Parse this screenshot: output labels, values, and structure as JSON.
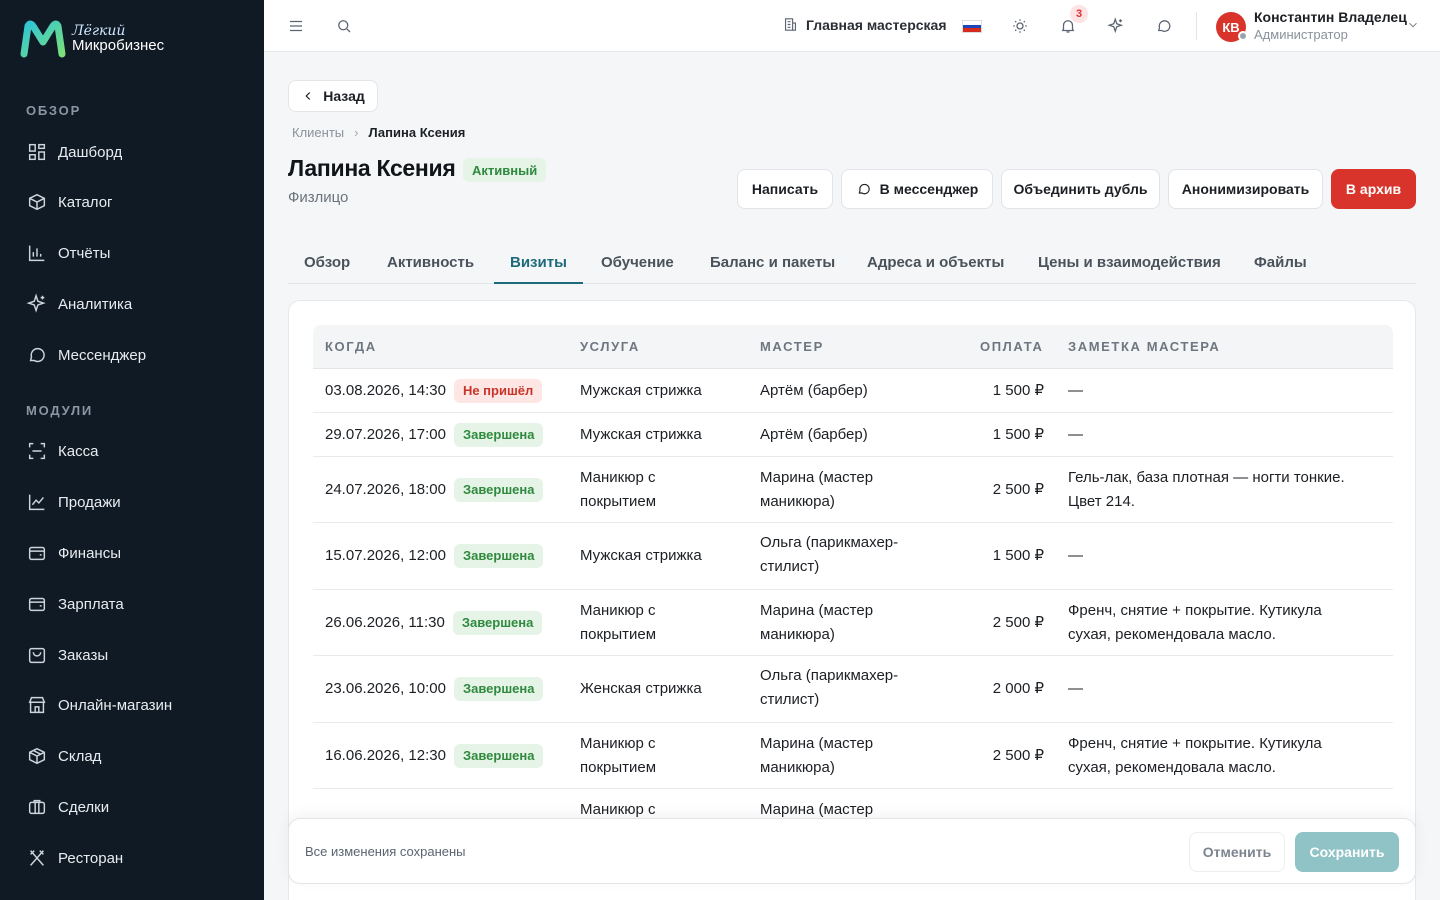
{
  "brand": {
    "line1": "Лёгкий",
    "line2": "Микробизнес"
  },
  "nav": {
    "section_overview": "ОБЗОР",
    "section_modules": "МОДУЛИ",
    "items": [
      {
        "label": "Дашборд",
        "icon": "grid-icon"
      },
      {
        "label": "Каталог",
        "icon": "box-icon"
      },
      {
        "label": "Отчёты",
        "icon": "bar-chart-icon"
      },
      {
        "label": "Аналитика",
        "icon": "sparkle-icon"
      },
      {
        "label": "Мессенджер",
        "icon": "chat-icon"
      },
      {
        "label": "Касса",
        "icon": "scan-icon"
      },
      {
        "label": "Продажи",
        "icon": "line-chart-icon"
      },
      {
        "label": "Финансы",
        "icon": "wallet-icon"
      },
      {
        "label": "Зарплата",
        "icon": "wallet-icon"
      },
      {
        "label": "Заказы",
        "icon": "bag-icon"
      },
      {
        "label": "Онлайн-магазин",
        "icon": "store-icon"
      },
      {
        "label": "Склад",
        "icon": "package-icon"
      },
      {
        "label": "Сделки",
        "icon": "briefcase-icon"
      },
      {
        "label": "Ресторан",
        "icon": "utensils-icon"
      }
    ]
  },
  "topbar": {
    "workshop": "Главная мастерская",
    "notifications_count": "3",
    "user_initials": "КВ",
    "user_name": "Константин Владелец",
    "user_role": "Администратор"
  },
  "page": {
    "back_label": "Назад",
    "breadcrumb_parent": "Клиенты",
    "breadcrumb_current": "Лапина Ксения",
    "title": "Лапина Ксения",
    "status": "Активный",
    "subtitle": "Физлицо",
    "actions": {
      "write": "Написать",
      "messenger": "В мессенджер",
      "merge": "Объединить дубль",
      "anonymize": "Анонимизировать",
      "archive": "В архив"
    },
    "tabs": [
      "Обзор",
      "Активность",
      "Визиты",
      "Обучение",
      "Баланс и пакеты",
      "Адреса и объекты",
      "Цены и взаимодействия",
      "Файлы"
    ]
  },
  "table": {
    "headers": {
      "when": "КОГДА",
      "service": "УСЛУГА",
      "master": "МАСТЕР",
      "payment": "ОПЛАТА",
      "note": "ЗАМЕТКА МАСТЕРА"
    },
    "rows": [
      {
        "date": "03.08.2026, 14:30",
        "status": "Не пришёл",
        "status_kind": "no",
        "service": "Мужская стрижка",
        "master": "Артём (барбер)",
        "payment": "1 500 ₽",
        "note": "—"
      },
      {
        "date": "29.07.2026, 17:00",
        "status": "Завершена",
        "status_kind": "ok",
        "service": "Мужская стрижка",
        "master": "Артём (барбер)",
        "payment": "1 500 ₽",
        "note": "—"
      },
      {
        "date": "24.07.2026, 18:00",
        "status": "Завершена",
        "status_kind": "ok",
        "service": "Маникюр с покрытием",
        "master": "Марина (мастер маникюра)",
        "payment": "2 500 ₽",
        "note": "Гель-лак, база плотная — ногти тонкие. Цвет 214."
      },
      {
        "date": "15.07.2026, 12:00",
        "status": "Завершена",
        "status_kind": "ok",
        "service": "Мужская стрижка",
        "master": "Ольга (парикмахер-стилист)",
        "payment": "1 500 ₽",
        "note": "—"
      },
      {
        "date": "26.06.2026, 11:30",
        "status": "Завершена",
        "status_kind": "ok",
        "service": "Маникюр с покрытием",
        "master": "Марина (мастер маникюра)",
        "payment": "2 500 ₽",
        "note": "Френч, снятие + покрытие. Кутикула сухая, рекомендовала масло."
      },
      {
        "date": "23.06.2026, 10:00",
        "status": "Завершена",
        "status_kind": "ok",
        "service": "Женская стрижка",
        "master": "Ольга (парикмахер-стилист)",
        "payment": "2 000 ₽",
        "note": "—"
      },
      {
        "date": "16.06.2026, 12:30",
        "status": "Завершена",
        "status_kind": "ok",
        "service": "Маникюр с покрытием",
        "master": "Марина (мастер маникюра)",
        "payment": "2 500 ₽",
        "note": "Френч, снятие + покрытие. Кутикула сухая, рекомендовала масло."
      },
      {
        "date": "",
        "status": "",
        "status_kind": "ok",
        "service": "Маникюр с",
        "master": "Марина (мастер",
        "payment": "",
        "note": ""
      }
    ]
  },
  "savebar": {
    "status": "Все изменения сохранены",
    "cancel": "Отменить",
    "save": "Сохранить"
  },
  "colors": {
    "sidebar_bg": "#0f1a24",
    "accent": "#1d6b7a",
    "danger": "#d9342b",
    "success": "#2f8a3e"
  }
}
